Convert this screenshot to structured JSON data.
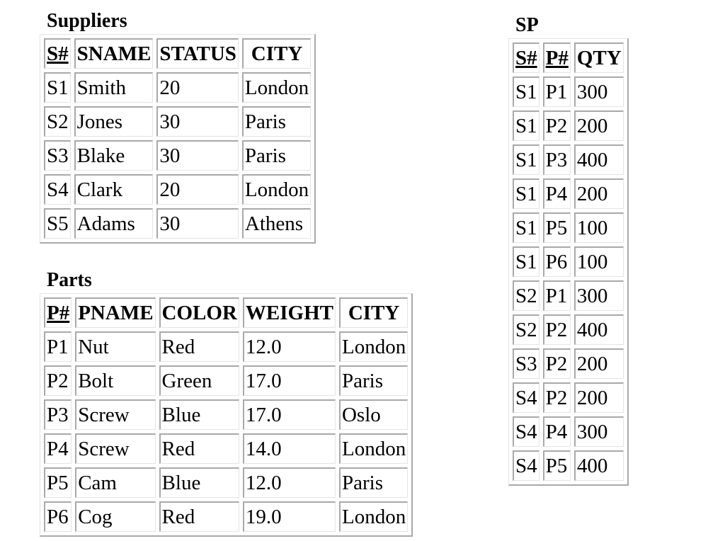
{
  "suppliers": {
    "title": "Suppliers",
    "columns": [
      {
        "label": "S#",
        "key": true
      },
      {
        "label": "SNAME",
        "key": false
      },
      {
        "label": "STATUS",
        "key": false
      },
      {
        "label": "CITY",
        "key": false
      }
    ],
    "rows": [
      [
        "S1",
        "Smith",
        "20",
        "London"
      ],
      [
        "S2",
        "Jones",
        "30",
        "Paris"
      ],
      [
        "S3",
        "Blake",
        "30",
        "Paris"
      ],
      [
        "S4",
        "Clark",
        "20",
        "London"
      ],
      [
        "S5",
        "Adams",
        "30",
        "Athens"
      ]
    ]
  },
  "parts": {
    "title": "Parts",
    "columns": [
      {
        "label": "P#",
        "key": true
      },
      {
        "label": "PNAME",
        "key": false
      },
      {
        "label": "COLOR",
        "key": false
      },
      {
        "label": "WEIGHT",
        "key": false
      },
      {
        "label": "CITY",
        "key": false
      }
    ],
    "rows": [
      [
        "P1",
        "Nut",
        "Red",
        "12.0",
        "London"
      ],
      [
        "P2",
        "Bolt",
        "Green",
        "17.0",
        "Paris"
      ],
      [
        "P3",
        "Screw",
        "Blue",
        "17.0",
        "Oslo"
      ],
      [
        "P4",
        "Screw",
        "Red",
        "14.0",
        "London"
      ],
      [
        "P5",
        "Cam",
        "Blue",
        "12.0",
        "Paris"
      ],
      [
        "P6",
        "Cog",
        "Red",
        "19.0",
        "London"
      ]
    ]
  },
  "sp": {
    "title": "SP",
    "columns": [
      {
        "label": "S#",
        "key": true
      },
      {
        "label": "P#",
        "key": true
      },
      {
        "label": "QTY",
        "key": false
      }
    ],
    "rows": [
      [
        "S1",
        "P1",
        "300"
      ],
      [
        "S1",
        "P2",
        "200"
      ],
      [
        "S1",
        "P3",
        "400"
      ],
      [
        "S1",
        "P4",
        "200"
      ],
      [
        "S1",
        "P5",
        "100"
      ],
      [
        "S1",
        "P6",
        "100"
      ],
      [
        "S2",
        "P1",
        "300"
      ],
      [
        "S2",
        "P2",
        "400"
      ],
      [
        "S3",
        "P2",
        "200"
      ],
      [
        "S4",
        "P2",
        "200"
      ],
      [
        "S4",
        "P4",
        "300"
      ],
      [
        "S4",
        "P5",
        "400"
      ]
    ]
  }
}
